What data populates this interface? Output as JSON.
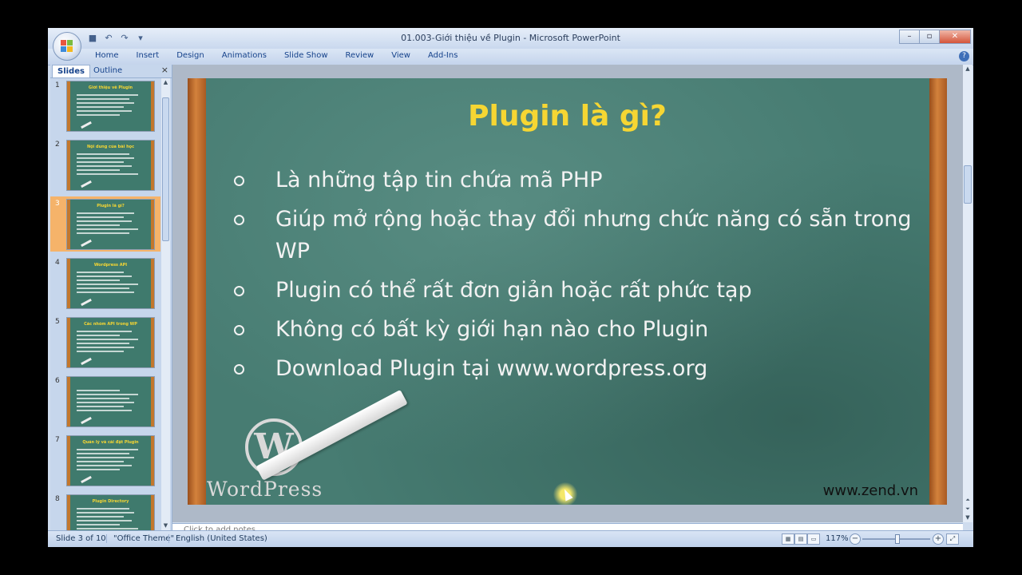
{
  "window": {
    "title": "01.003-Giới thiệu về Plugin - Microsoft PowerPoint",
    "controls": {
      "minimize": "–",
      "restore": "▫",
      "close": "✕"
    }
  },
  "quick_access": {
    "save_icon": "save-icon",
    "undo_icon": "undo-icon",
    "redo_icon": "redo-icon"
  },
  "ribbon": {
    "tabs": [
      "Home",
      "Insert",
      "Design",
      "Animations",
      "Slide Show",
      "Review",
      "View",
      "Add-Ins"
    ],
    "help": "?"
  },
  "left_pane": {
    "tabs": [
      "Slides",
      "Outline"
    ],
    "close": "×",
    "selected_index": 2,
    "thumbnails": [
      {
        "number": "1",
        "title": "Giới thiệu về Plugin"
      },
      {
        "number": "2",
        "title": "Nội dung của bài học"
      },
      {
        "number": "3",
        "title": "Plugin là gì?"
      },
      {
        "number": "4",
        "title": "Wordpress API"
      },
      {
        "number": "5",
        "title": "Các nhóm API trong WP"
      },
      {
        "number": "6",
        "title": ""
      },
      {
        "number": "7",
        "title": "Quản lý và cài đặt Plugin"
      },
      {
        "number": "8",
        "title": "Plugin Directory"
      }
    ]
  },
  "slide": {
    "title": "Plugin là gì?",
    "bullets": [
      "Là những tập tin chứa mã PHP",
      "Giúp mở rộng hoặc thay đổi nhưng chức năng có sẵn trong WP",
      "Plugin có thể rất đơn giản hoặc rất phức tạp",
      "Không có bất kỳ giới hạn nào cho Plugin",
      "Download Plugin tại www.wordpress.org"
    ],
    "logo_glyph": "W",
    "logo_text": "WordPress",
    "site": "www.zend.vn"
  },
  "notes": {
    "placeholder": "Click to add notes"
  },
  "status": {
    "slide_info": "Slide 3 of 10",
    "theme": "\"Office Theme\"",
    "language": "English (United States)",
    "zoom": "117%",
    "zoom_fraction": 0.52
  }
}
